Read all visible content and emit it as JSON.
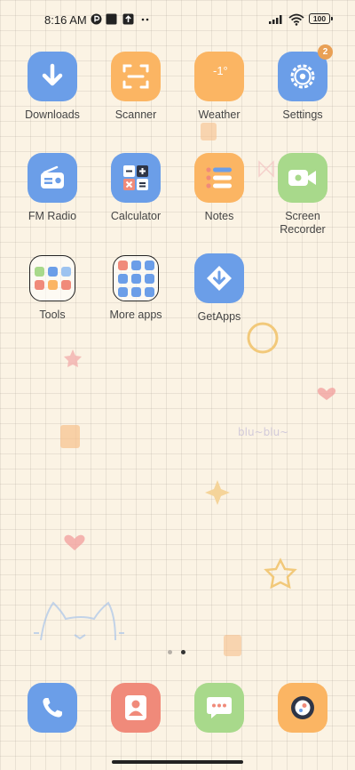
{
  "status_bar": {
    "time": "8:16 AM",
    "battery": "100"
  },
  "apps": {
    "downloads": "Downloads",
    "scanner": "Scanner",
    "weather": "Weather",
    "weather_temp": "-1°",
    "settings": "Settings",
    "settings_badge": "2",
    "fm_radio": "FM Radio",
    "calculator": "Calculator",
    "notes": "Notes",
    "screen_recorder": "Screen Recorder",
    "tools": "Tools",
    "more_apps": "More apps",
    "getapps": "GetApps"
  },
  "wallpaper": {
    "doodle_text": "blu~blu~"
  },
  "page_indicator": {
    "pages": 2,
    "current": 2
  },
  "dock": [
    "phone-icon",
    "contacts-icon",
    "messages-icon",
    "camera-icon"
  ],
  "colors": {
    "blue": "#6b9ee8",
    "orange": "#fbb563",
    "green": "#a8d98b",
    "red": "#f08a7a",
    "background": "#fbf3e4"
  }
}
